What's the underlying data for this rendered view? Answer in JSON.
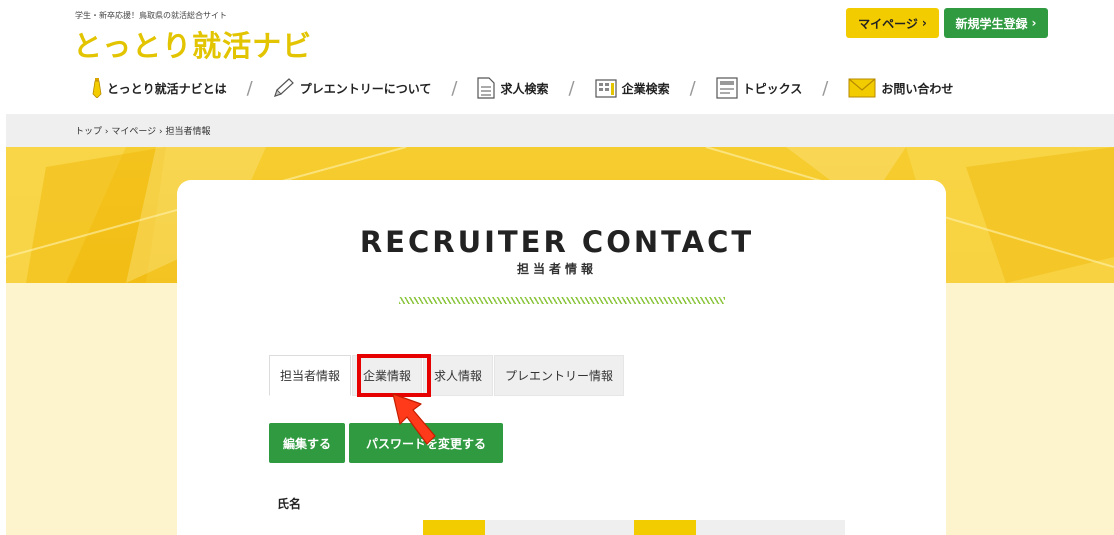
{
  "site": {
    "tagline": "学生・新卒応援！鳥取県の就活総合サイト",
    "logo": "とっとり就活ナビ"
  },
  "header_buttons": {
    "mypage": "マイページ",
    "register": "新規学生登録"
  },
  "nav": {
    "items": [
      {
        "label": "とっとり就活ナビとは",
        "icon": "tie-icon"
      },
      {
        "label": "プレエントリーについて",
        "icon": "pencil-icon"
      },
      {
        "label": "求人検索",
        "icon": "document-icon"
      },
      {
        "label": "企業検索",
        "icon": "building-icon"
      },
      {
        "label": "トピックス",
        "icon": "notepad-icon"
      },
      {
        "label": "お問い合わせ",
        "icon": "envelope-icon"
      }
    ],
    "separator": "/"
  },
  "breadcrumb": "トップ › マイページ › 担当者情報",
  "page": {
    "title_en": "RECRUITER CONTACT",
    "title_ja": "担当者情報"
  },
  "tabs": [
    {
      "label": "担当者情報",
      "active": true
    },
    {
      "label": "企業情報",
      "active": false,
      "highlighted": true
    },
    {
      "label": "求人情報",
      "active": false
    },
    {
      "label": "プレエントリー情報",
      "active": false
    }
  ],
  "actions": {
    "edit": "編集する",
    "change_password": "パスワードを変更する"
  },
  "form": {
    "name_label": "氏名"
  },
  "colors": {
    "brand_yellow": "#f3cc00",
    "brand_green": "#2f9a3f",
    "highlight_red": "#e60000"
  }
}
